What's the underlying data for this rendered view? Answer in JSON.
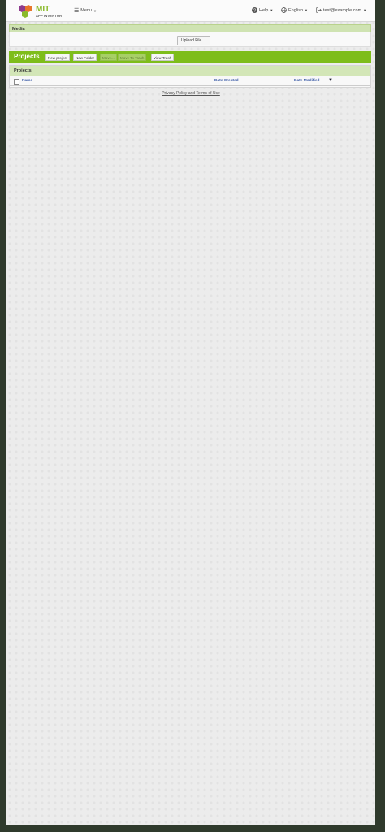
{
  "header": {
    "logo_title": "MIT",
    "logo_subtitle": "APP INVENTOR",
    "menu_label": "Menu",
    "help_label": "Help",
    "language_label": "English",
    "account_label": "test@example.com"
  },
  "media": {
    "title": "Media",
    "upload_label": "Upload File ..."
  },
  "projects_toolbar": {
    "title": "Projects",
    "buttons": {
      "new_project": "New project",
      "new_folder": "New Folder",
      "move": "Move...",
      "move_to_trash": "Move To Trash",
      "view_trash": "View Trash"
    }
  },
  "projects_table": {
    "title": "Projects",
    "columns": [
      "Name",
      "Date Created",
      "Date Modified"
    ],
    "sort_indicator": "▼"
  },
  "footer": {
    "privacy_link": "Privacy Policy and Terms of Use"
  },
  "colors": {
    "accent_green": "#7ebd1b",
    "section_green": "#cfe3b2",
    "link_blue": "#3a5aa6"
  }
}
